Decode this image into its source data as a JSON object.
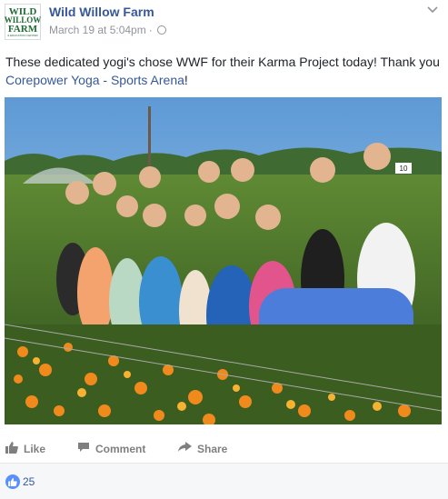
{
  "post": {
    "page_name": "Wild Willow Farm",
    "logo": {
      "line1": "WILD",
      "line2": "WILLOW",
      "line3": "FARM",
      "line4": "& EDUCATION CENTER"
    },
    "date": "March 19 at 5:04pm",
    "separator": "·",
    "privacy_icon": "globe-icon",
    "text_before": "These dedicated yogi's chose WWF for their Karma Project today! Thank you ",
    "link_text": "Corepower Yoga - Sports Arena",
    "text_after": "!",
    "photo_sign": "10",
    "menu_icon": "chevron-down-icon"
  },
  "actions": {
    "like_label": "Like",
    "comment_label": "Comment",
    "share_label": "Share"
  },
  "reactions": {
    "count": "25",
    "icon": "thumbs-up-icon"
  },
  "colors": {
    "link": "#365899",
    "meta": "#90949c",
    "action": "#7f7f7f",
    "like_badge": "#5890ff",
    "footer_bg": "#f6f7f9"
  }
}
